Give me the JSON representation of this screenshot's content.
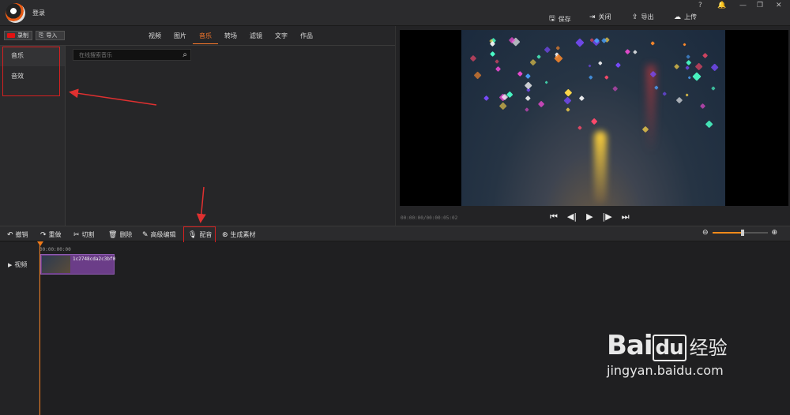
{
  "topbar": {
    "login": "登录",
    "controls": [
      "?",
      "🔔",
      "—",
      "❐",
      "✕"
    ],
    "buttons": [
      {
        "icon": "save-icon",
        "glyph": "🖫",
        "label": "保存"
      },
      {
        "icon": "close-doc-icon",
        "glyph": "⇥",
        "label": "关闭"
      },
      {
        "icon": "export-icon",
        "glyph": "⇪",
        "label": "导出"
      },
      {
        "icon": "upload-icon",
        "glyph": "☁",
        "label": "上传"
      }
    ]
  },
  "media": {
    "record_label": "录制",
    "import_label": "导入",
    "tabs": [
      "视频",
      "图片",
      "音乐",
      "转场",
      "滤镜",
      "文字",
      "作品"
    ],
    "active_tab": 2,
    "categories": [
      "音乐",
      "音效"
    ],
    "search_placeholder": "在线搜索音乐"
  },
  "preview": {
    "timecode": "00:00:00/00:00:05:02"
  },
  "toolbar": {
    "undo": "撤销",
    "redo": "重做",
    "cut": "切割",
    "delete": "删除",
    "advanced_edit": "高级编辑",
    "dub": "配音",
    "generate": "生成素材",
    "zoom_level": 0.55
  },
  "timeline": {
    "track_label": "视频",
    "ruler_time": "00:00:00:00",
    "clip_name": "1c2748cda2c3bf0"
  },
  "watermark": {
    "brand": "Bai",
    "brand2": "du",
    "cn": "经验",
    "url": "jingyan.baidu.com"
  }
}
